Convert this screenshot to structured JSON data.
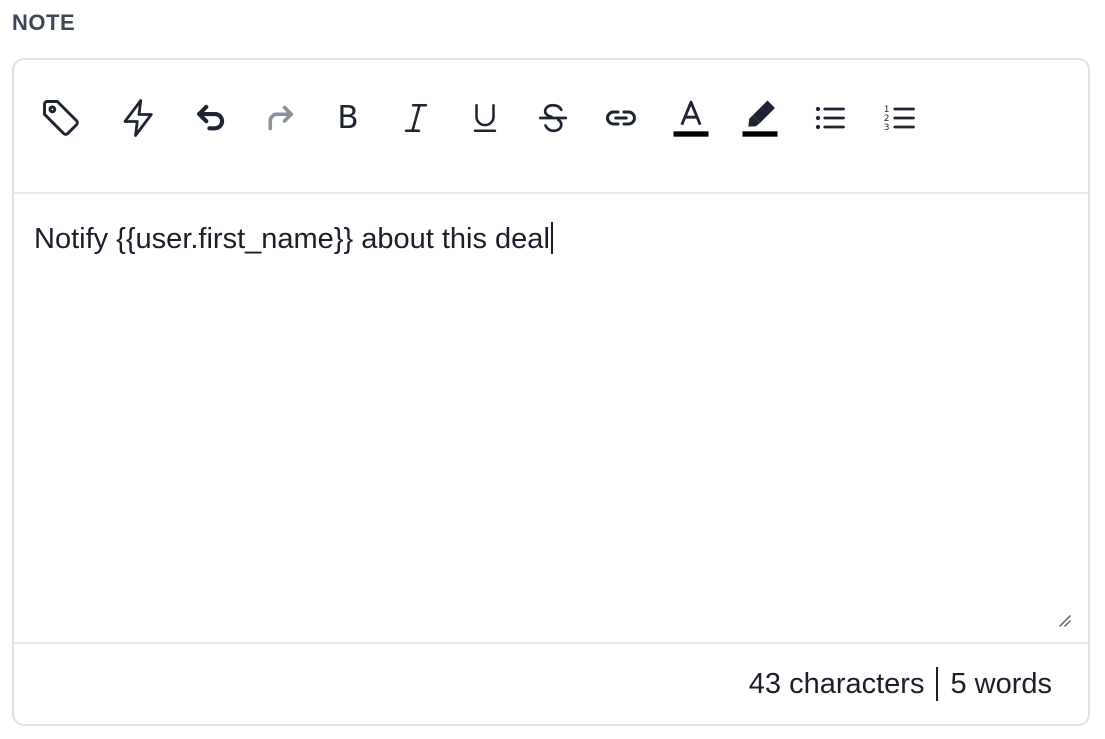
{
  "field": {
    "label": "NOTE"
  },
  "toolbar": {
    "buttons": [
      {
        "name": "tag-icon"
      },
      {
        "name": "lightning-icon"
      },
      {
        "name": "undo-icon"
      },
      {
        "name": "redo-icon",
        "disabled": true
      },
      {
        "name": "bold-icon",
        "glyph": "B"
      },
      {
        "name": "italic-icon",
        "glyph": "I"
      },
      {
        "name": "underline-icon",
        "glyph": "U"
      },
      {
        "name": "strikethrough-icon",
        "glyph": "S"
      },
      {
        "name": "link-icon"
      },
      {
        "name": "text-color-icon",
        "glyph": "A",
        "color": "#000000"
      },
      {
        "name": "highlight-icon",
        "color": "#000000"
      },
      {
        "name": "bullet-list-icon"
      },
      {
        "name": "numbered-list-icon"
      }
    ]
  },
  "editor": {
    "content": "Notify {{user.first_name}} about this deal"
  },
  "footer": {
    "characters": "43 characters",
    "words": "5 words"
  },
  "colors": {
    "label": "#3f4756",
    "border": "#dfe2e8",
    "text": "#1b1f2a",
    "disabled": "#8a909c"
  }
}
